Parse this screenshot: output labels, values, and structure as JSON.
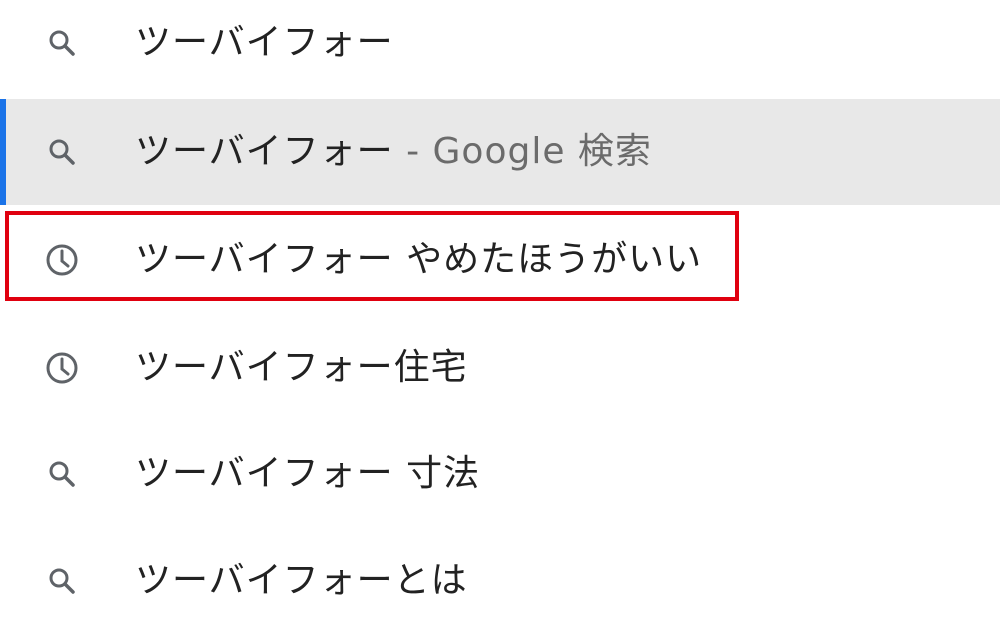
{
  "suggestions": [
    {
      "icon": "search-icon",
      "text": "ツーバイフォー",
      "suffix": ""
    },
    {
      "icon": "search-icon",
      "text": "ツーバイフォー",
      "suffix": " - Google 検索"
    },
    {
      "icon": "history-icon",
      "text": "ツーバイフォー やめたほうがいい",
      "suffix": ""
    },
    {
      "icon": "history-icon",
      "text": "ツーバイフォー住宅",
      "suffix": ""
    },
    {
      "icon": "search-icon",
      "text": "ツーバイフォー 寸法",
      "suffix": ""
    },
    {
      "icon": "search-icon",
      "text": "ツーバイフォーとは",
      "suffix": ""
    }
  ],
  "selected_index": 1,
  "highlighted_index": 2,
  "colors": {
    "selected_background": "#e8e8e8",
    "selected_accent": "#1a73e8",
    "highlight_border": "#e0000f",
    "text": "#222222",
    "suffix_text": "#6b6b6b",
    "icon": "#5f6368"
  }
}
